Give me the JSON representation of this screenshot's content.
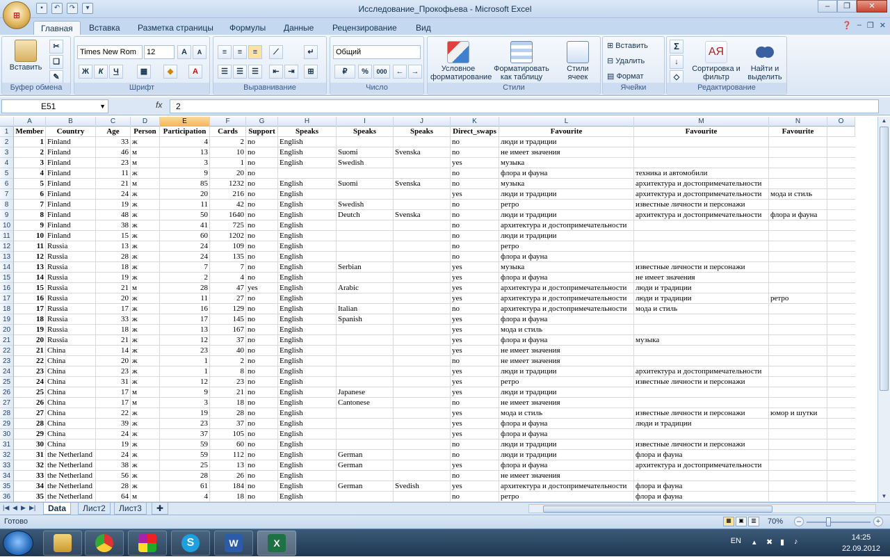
{
  "window": {
    "title": "Исследование_Прокофьева - Microsoft Excel",
    "minimize": "–",
    "restore": "❐",
    "close": "✕"
  },
  "tabs": [
    "Главная",
    "Вставка",
    "Разметка страницы",
    "Формулы",
    "Данные",
    "Рецензирование",
    "Вид"
  ],
  "active_tab": "Главная",
  "ribbon": {
    "clipboard": {
      "label": "Буфер обмена",
      "paste": "Вставить"
    },
    "font": {
      "label": "Шрифт",
      "name": "Times New Rom",
      "size": "12",
      "bold": "Ж",
      "italic": "К",
      "underline": "Ч"
    },
    "alignment": {
      "label": "Выравнивание"
    },
    "number": {
      "label": "Число",
      "format": "Общий",
      "percent": "%",
      "thousands": "000"
    },
    "styles": {
      "label": "Стили",
      "conditional": "Условное форматирование",
      "as_table": "Форматировать как таблицу",
      "cell_styles": "Стили ячеек"
    },
    "cells": {
      "label": "Ячейки",
      "insert": "Вставить",
      "delete": "Удалить",
      "format": "Формат"
    },
    "editing": {
      "label": "Редактирование",
      "sum": "Σ",
      "sort": "Сортировка и фильтр",
      "find": "Найти и выделить"
    }
  },
  "formula_bar": {
    "name_box": "E51",
    "fx": "fx",
    "value": "2"
  },
  "columns": [
    "A",
    "B",
    "C",
    "D",
    "E",
    "F",
    "G",
    "H",
    "I",
    "J",
    "K",
    "L",
    "M",
    "N",
    "O"
  ],
  "selected_column": "E",
  "header_row": [
    "Member",
    "Country",
    "Age",
    "Person",
    "Participation",
    "Cards",
    "Support",
    "Speaks",
    "Speaks",
    "Speaks",
    "Direct_swaps",
    "Favourite",
    "Favourite",
    "Favourite",
    ""
  ],
  "rows": [
    [
      "1",
      "Finland",
      "33",
      "ж",
      "4",
      "2",
      "no",
      "English",
      "",
      "",
      "no",
      "люди и традиции",
      "",
      ""
    ],
    [
      "2",
      "Finland",
      "46",
      "м",
      "13",
      "10",
      "no",
      "English",
      "Suomi",
      "Svenska",
      "no",
      "не имеет значения",
      "",
      ""
    ],
    [
      "3",
      "Finland",
      "23",
      "м",
      "3",
      "1",
      "no",
      "English",
      "Swedish",
      "",
      "yes",
      "музыка",
      "",
      ""
    ],
    [
      "4",
      "Finland",
      "11",
      "ж",
      "9",
      "20",
      "no",
      "",
      "",
      "",
      "no",
      "флора и фауна",
      "техника и автомобили",
      ""
    ],
    [
      "5",
      "Finland",
      "21",
      "м",
      "85",
      "1232",
      "no",
      "English",
      "Suomi",
      "Svenska",
      "no",
      "музыка",
      "архитектура и достопримечательности",
      ""
    ],
    [
      "6",
      "Finland",
      "24",
      "ж",
      "20",
      "216",
      "no",
      "English",
      "",
      "",
      "yes",
      "люди и традиции",
      "архитектура и достопримечательности",
      "мода и стиль"
    ],
    [
      "7",
      "Finland",
      "19",
      "ж",
      "11",
      "42",
      "no",
      "English",
      "Swedish",
      "",
      "no",
      "ретро",
      "известные личности и персонажи",
      ""
    ],
    [
      "8",
      "Finland",
      "48",
      "ж",
      "50",
      "1640",
      "no",
      "English",
      "Deutch",
      "Svenska",
      "no",
      "люди и традиции",
      "архитектура и достопримечательности",
      "флора и фауна"
    ],
    [
      "9",
      "Finland",
      "38",
      "ж",
      "41",
      "725",
      "no",
      "English",
      "",
      "",
      "no",
      "архитектура и достопримечательности",
      "",
      ""
    ],
    [
      "10",
      "Finland",
      "15",
      "ж",
      "60",
      "1202",
      "no",
      "English",
      "",
      "",
      "no",
      "люди и традиции",
      "",
      ""
    ],
    [
      "11",
      "Russia",
      "13",
      "ж",
      "24",
      "109",
      "no",
      "English",
      "",
      "",
      "no",
      "ретро",
      "",
      ""
    ],
    [
      "12",
      "Russia",
      "28",
      "ж",
      "24",
      "135",
      "no",
      "English",
      "",
      "",
      "no",
      "флора и фауна",
      "",
      ""
    ],
    [
      "13",
      "Russia",
      "18",
      "ж",
      "7",
      "7",
      "no",
      "English",
      "Serbian",
      "",
      "yes",
      "музыка",
      "известные личности и персонажи",
      ""
    ],
    [
      "14",
      "Russia",
      "19",
      "ж",
      "2",
      "4",
      "no",
      "English",
      "",
      "",
      "yes",
      "флора и фауна",
      "не имеет значения",
      ""
    ],
    [
      "15",
      "Russia",
      "21",
      "м",
      "28",
      "47",
      "yes",
      "English",
      "Arabic",
      "",
      "yes",
      "архитектура и достопримечательности",
      "люди и традиции",
      ""
    ],
    [
      "16",
      "Russia",
      "20",
      "ж",
      "11",
      "27",
      "no",
      "English",
      "",
      "",
      "yes",
      "архитектура и достопримечательности",
      "люди и традиции",
      "ретро"
    ],
    [
      "17",
      "Russia",
      "17",
      "ж",
      "16",
      "129",
      "no",
      "English",
      "Italian",
      "",
      "no",
      "архитектура и достопримечательности",
      "мода и стиль",
      ""
    ],
    [
      "18",
      "Russia",
      "33",
      "ж",
      "17",
      "145",
      "no",
      "English",
      "Spanish",
      "",
      "yes",
      "флора и фауна",
      "",
      ""
    ],
    [
      "19",
      "Russia",
      "18",
      "ж",
      "13",
      "167",
      "no",
      "English",
      "",
      "",
      "yes",
      "мода и стиль",
      "",
      ""
    ],
    [
      "20",
      "Russia",
      "21",
      "ж",
      "12",
      "37",
      "no",
      "English",
      "",
      "",
      "yes",
      "флора и фауна",
      "музыка",
      ""
    ],
    [
      "21",
      "China",
      "14",
      "ж",
      "23",
      "40",
      "no",
      "English",
      "",
      "",
      "yes",
      "не имеет значения",
      "",
      ""
    ],
    [
      "22",
      "China",
      "20",
      "ж",
      "1",
      "2",
      "no",
      "English",
      "",
      "",
      "no",
      "не имеет значения",
      "",
      ""
    ],
    [
      "23",
      "China",
      "23",
      "ж",
      "1",
      "8",
      "no",
      "English",
      "",
      "",
      "yes",
      "люди и традиции",
      "архитектура и достопримечательности",
      ""
    ],
    [
      "24",
      "China",
      "31",
      "ж",
      "12",
      "23",
      "no",
      "English",
      "",
      "",
      "yes",
      "ретро",
      "известные личности и персонажи",
      ""
    ],
    [
      "25",
      "China",
      "17",
      "м",
      "9",
      "21",
      "no",
      "English",
      "Japanese",
      "",
      "yes",
      "люди и традиции",
      "",
      ""
    ],
    [
      "26",
      "China",
      "17",
      "м",
      "3",
      "18",
      "no",
      "English",
      "Cantonese",
      "",
      "no",
      "не имеет значения",
      "",
      ""
    ],
    [
      "27",
      "China",
      "22",
      "ж",
      "19",
      "28",
      "no",
      "English",
      "",
      "",
      "yes",
      "мода и стиль",
      "известные личности и персонажи",
      "юмор и шутки"
    ],
    [
      "28",
      "China",
      "39",
      "ж",
      "23",
      "37",
      "no",
      "English",
      "",
      "",
      "yes",
      "флора и фауна",
      "люди и традиции",
      ""
    ],
    [
      "29",
      "China",
      "24",
      "ж",
      "37",
      "105",
      "no",
      "English",
      "",
      "",
      "yes",
      "флора и фауна",
      "",
      ""
    ],
    [
      "30",
      "China",
      "19",
      "ж",
      "59",
      "60",
      "no",
      "English",
      "",
      "",
      "no",
      "люди и традиции",
      "известные личности и персонажи",
      ""
    ],
    [
      "31",
      "the Netherland",
      "24",
      "ж",
      "59",
      "112",
      "no",
      "English",
      "German",
      "",
      "no",
      "люди и традиции",
      "флора и фауна",
      ""
    ],
    [
      "32",
      "the Netherland",
      "38",
      "ж",
      "25",
      "13",
      "no",
      "English",
      "German",
      "",
      "yes",
      "флора и фауна",
      "архитектура и достопримечательности",
      ""
    ],
    [
      "33",
      "the Netherland",
      "56",
      "ж",
      "28",
      "26",
      "no",
      "English",
      "",
      "",
      "no",
      "не имеет значения",
      "",
      ""
    ],
    [
      "34",
      "the Netherland",
      "28",
      "ж",
      "61",
      "184",
      "no",
      "English",
      "German",
      "Svedish",
      "yes",
      "архитектура и достопримечательности",
      "флора и фауна",
      ""
    ],
    [
      "35",
      "the Netherland",
      "64",
      "м",
      "4",
      "18",
      "no",
      "English",
      "",
      "",
      "no",
      "ретро",
      "флора и фауна",
      ""
    ]
  ],
  "sheets": [
    "Data",
    "Лист2",
    "Лист3"
  ],
  "active_sheet": "Data",
  "status": {
    "ready": "Готово",
    "zoom": "70%",
    "zoom_level_percent": 70
  },
  "taskbar": {
    "lang": "EN",
    "time": "14:25",
    "date": "22.09.2012"
  },
  "colors": {
    "selected_column": "#f2b656",
    "ribbon": "#dbe7f5",
    "excel_green": "#1e7145"
  }
}
